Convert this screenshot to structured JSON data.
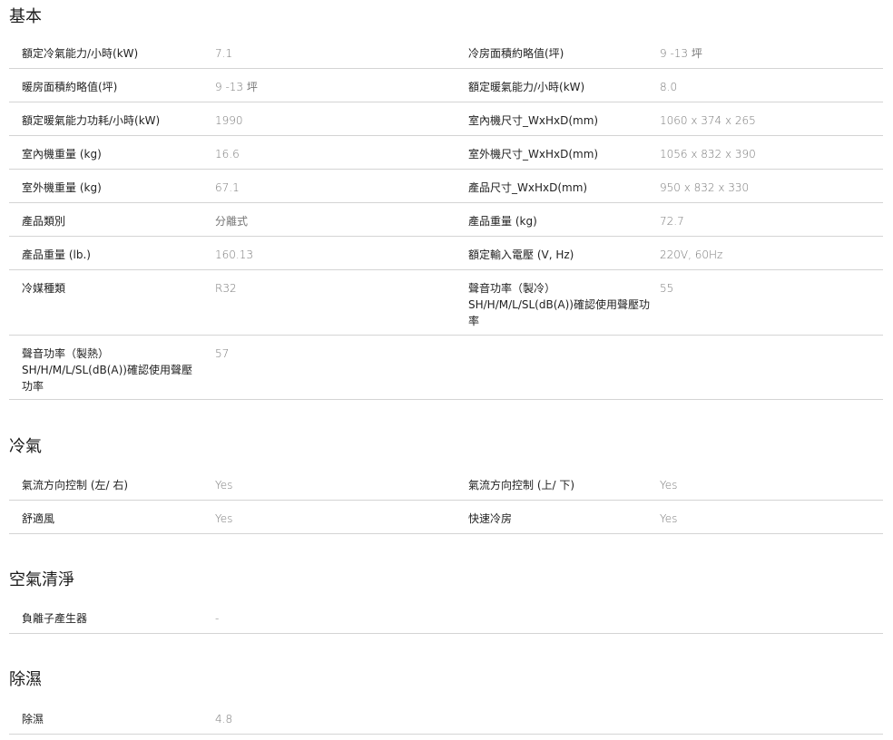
{
  "sections": {
    "basic": {
      "title": "基本",
      "rows": [
        {
          "l1": "額定冷氣能力/小時(kW)",
          "v1": "7.1",
          "l2": "冷房面積約略值(坪)",
          "v2": "9 -13 坪"
        },
        {
          "l1": "暖房面積約略值(坪)",
          "v1": "9 -13 坪",
          "l2": "額定暖氣能力/小時(kW)",
          "v2": "8.0"
        },
        {
          "l1": "額定暖氣能力功耗/小時(kW)",
          "v1": "1990",
          "l2": "室內機尺寸_WxHxD(mm)",
          "v2": "1060 x 374 x 265"
        },
        {
          "l1": "室內機重量 (kg)",
          "v1": "16.6",
          "l2": "室外機尺寸_WxHxD(mm)",
          "v2": "1056 x 832 x 390"
        },
        {
          "l1": "室外機重量 (kg)",
          "v1": "67.1",
          "l2": "產品尺寸_WxHxD(mm)",
          "v2": "950 x 832 x 330"
        },
        {
          "l1": "產品類別",
          "v1": "分離式",
          "l2": "產品重量 (kg)",
          "v2": "72.7"
        },
        {
          "l1": "產品重量 (lb.)",
          "v1": "160.13",
          "l2": "額定輸入電壓 (V, Hz)",
          "v2": "220V, 60Hz"
        },
        {
          "l1": "冷媒種類",
          "v1": "R32",
          "l2": "聲音功率（製冷）SH/H/M/L/SL(dB(A))確認使用聲壓功率",
          "v2": "55"
        },
        {
          "l1": "聲音功率（製熱）SH/H/M/L/SL(dB(A))確認使用聲壓功率",
          "v1": "57",
          "l2": "",
          "v2": ""
        }
      ]
    },
    "cooling": {
      "title": "冷氣",
      "rows": [
        {
          "l1": "氣流方向控制 (左/ 右)",
          "v1": "Yes",
          "l2": "氣流方向控制 (上/ 下)",
          "v2": "Yes"
        },
        {
          "l1": "舒適風",
          "v1": "Yes",
          "l2": "快速冷房",
          "v2": "Yes"
        }
      ]
    },
    "air_purify": {
      "title": "空氣清淨",
      "rows": [
        {
          "l1": "負離子產生器",
          "v1": "-",
          "l2": "",
          "v2": ""
        }
      ]
    },
    "dehumidify": {
      "title": "除濕",
      "rows": [
        {
          "l1": "除濕",
          "v1": "4.8",
          "l2": "",
          "v2": ""
        }
      ]
    }
  }
}
